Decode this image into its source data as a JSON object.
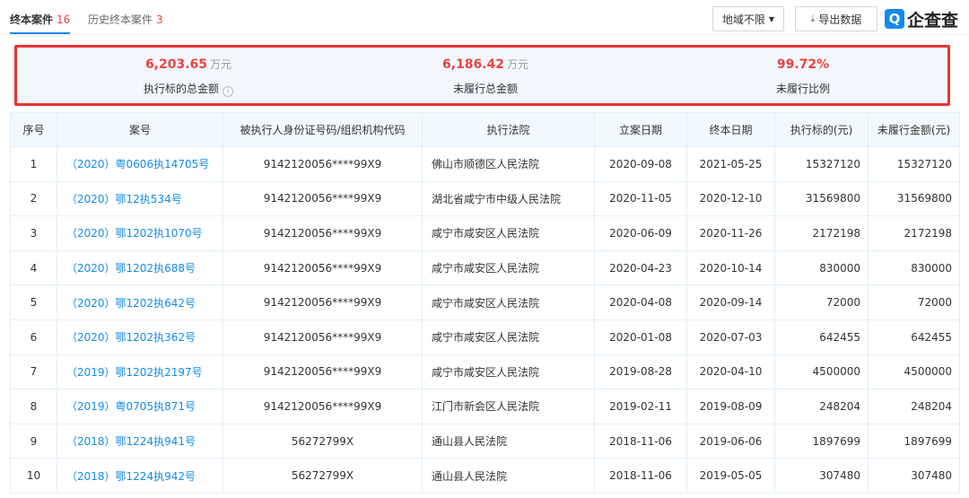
{
  "tabs": [
    {
      "label": "终本案件",
      "count": "16"
    },
    {
      "label": "历史终本案件",
      "count": "3"
    }
  ],
  "toolbar": {
    "region_label": "地域不限",
    "export_label": "导出数据"
  },
  "logo": {
    "mark": "Q",
    "text": "企查查"
  },
  "summary": {
    "total_target": {
      "value": "6,203.65",
      "unit": "万元",
      "label": "执行标的总金额"
    },
    "total_unfulfilled": {
      "value": "6,186.42",
      "unit": "万元",
      "label": "未履行总金额"
    },
    "unfulfilled_ratio": {
      "value": "99.72%",
      "label": "未履行比例"
    }
  },
  "table": {
    "headers": [
      "序号",
      "案号",
      "被执行人身份证号码/组织机构代码",
      "执行法院",
      "立案日期",
      "终本日期",
      "执行标的(元)",
      "未履行金额(元)"
    ],
    "rows": [
      [
        "1",
        "（2020）粤0606执14705号",
        "9142120056****99X9",
        "佛山市顺德区人民法院",
        "2020-09-08",
        "2021-05-25",
        "15327120",
        "15327120"
      ],
      [
        "2",
        "（2020）鄂12执534号",
        "9142120056****99X9",
        "湖北省咸宁市中级人民法院",
        "2020-11-05",
        "2020-12-10",
        "31569800",
        "31569800"
      ],
      [
        "3",
        "（2020）鄂1202执1070号",
        "9142120056****99X9",
        "咸宁市咸安区人民法院",
        "2020-06-09",
        "2020-11-26",
        "2172198",
        "2172198"
      ],
      [
        "4",
        "（2020）鄂1202执688号",
        "9142120056****99X9",
        "咸宁市咸安区人民法院",
        "2020-04-23",
        "2020-10-14",
        "830000",
        "830000"
      ],
      [
        "5",
        "（2020）鄂1202执642号",
        "9142120056****99X9",
        "咸宁市咸安区人民法院",
        "2020-04-08",
        "2020-09-14",
        "72000",
        "72000"
      ],
      [
        "6",
        "（2020）鄂1202执362号",
        "9142120056****99X9",
        "咸宁市咸安区人民法院",
        "2020-01-08",
        "2020-07-03",
        "642455",
        "642455"
      ],
      [
        "7",
        "（2019）鄂1202执2197号",
        "9142120056****99X9",
        "咸宁市咸安区人民法院",
        "2019-08-28",
        "2020-04-10",
        "4500000",
        "4500000"
      ],
      [
        "8",
        "（2019）粤0705执871号",
        "9142120056****99X9",
        "江门市新会区人民法院",
        "2019-02-11",
        "2019-08-09",
        "248204",
        "248204"
      ],
      [
        "9",
        "（2018）鄂1224执941号",
        "56272799X",
        "通山县人民法院",
        "2018-11-06",
        "2019-06-06",
        "1897699",
        "1897699"
      ],
      [
        "10",
        "（2018）鄂1224执942号",
        "56272799X",
        "通山县人民法院",
        "2018-11-06",
        "2019-05-05",
        "307480",
        "307480"
      ]
    ]
  },
  "colors": {
    "accent": "#128bed",
    "highlight": "#f04142",
    "summary_border": "#e93333"
  }
}
